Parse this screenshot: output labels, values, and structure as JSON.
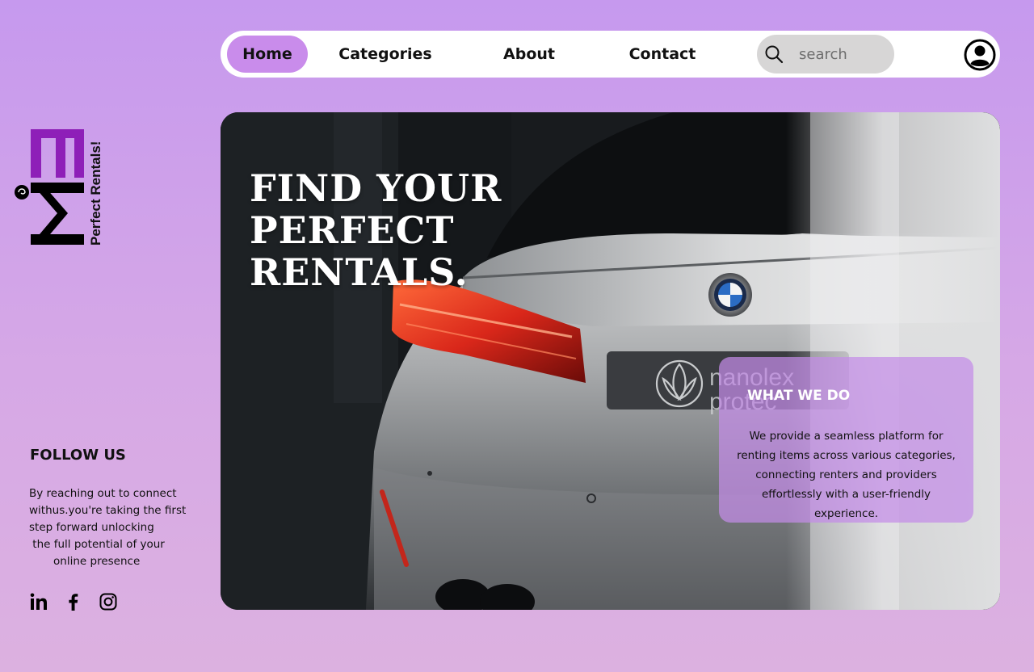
{
  "nav": {
    "items": [
      {
        "label": "Home",
        "active": true
      },
      {
        "label": "Categories"
      },
      {
        "label": "About"
      },
      {
        "label": "Contact"
      }
    ],
    "search": {
      "placeholder": "search",
      "icon": "search-icon"
    },
    "profile_icon": "user-circle-icon"
  },
  "brand": {
    "logo_letters": "MET",
    "tagline": "Perfect Rentals!"
  },
  "follow": {
    "title": "FOLLOW US",
    "text": "By reaching out to connect\nwithus.you're taking the first\nstep forward unlocking\n the full potential of your\n       online presence",
    "social": [
      "linkedin-icon",
      "facebook-icon",
      "instagram-icon"
    ]
  },
  "hero": {
    "title_lines": [
      "FIND YOUR",
      "PERFECT",
      "RENTALS."
    ],
    "plate_text": [
      "nanolex",
      "protec"
    ],
    "card": {
      "title": "WHAT WE DO",
      "body": "We provide a seamless platform for renting items across various categories, connecting renters and providers effortlessly with a user-friendly experience."
    }
  },
  "colors": {
    "accent": "#c98ceb",
    "logo_purple": "#8e1fb8",
    "background_top": "#c699ee",
    "background_bottom": "#dcb1e0"
  }
}
